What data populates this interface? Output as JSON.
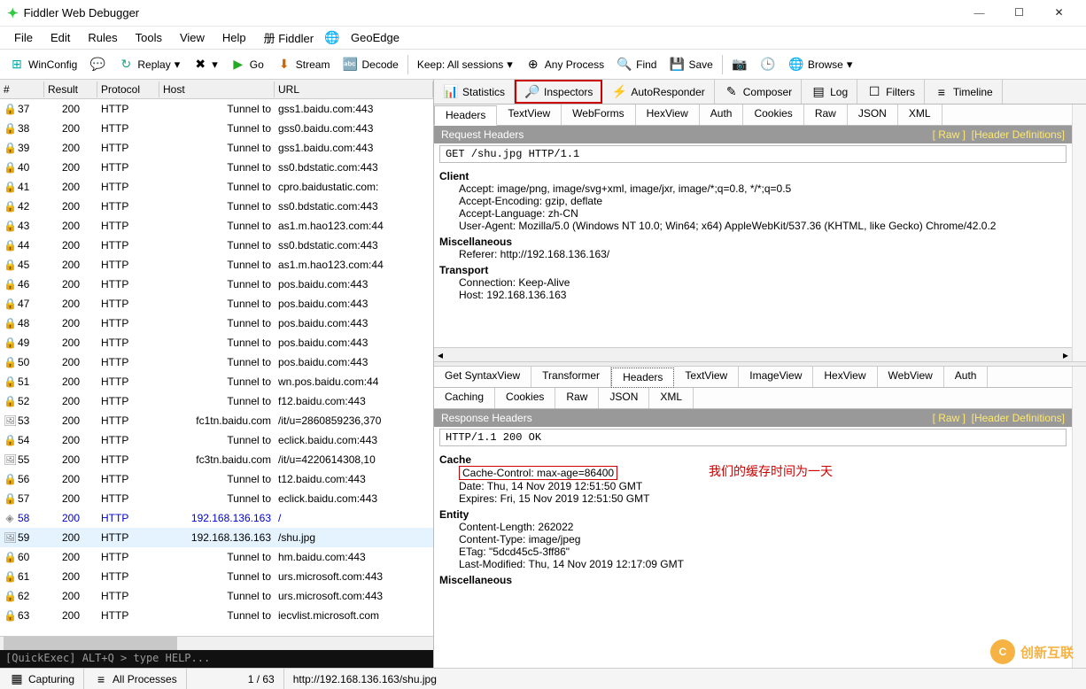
{
  "window": {
    "title": "Fiddler Web Debugger"
  },
  "winctrl": {
    "min": "—",
    "max": "☐",
    "close": "✕"
  },
  "menu": [
    "File",
    "Edit",
    "Rules",
    "Tools",
    "View",
    "Help",
    "册 Fiddler",
    "GeoEdge"
  ],
  "toolbar": {
    "winconfig": "WinConfig",
    "replay": "Replay",
    "go": "Go",
    "stream": "Stream",
    "decode": "Decode",
    "keep": "Keep: All sessions",
    "anyproc": "Any Process",
    "find": "Find",
    "save": "Save",
    "browse": "Browse"
  },
  "sess_cols": {
    "num": "#",
    "result": "Result",
    "protocol": "Protocol",
    "host": "Host",
    "url": "URL"
  },
  "sessions": [
    {
      "n": "37",
      "r": "200",
      "p": "HTTP",
      "h": "Tunnel to",
      "u": "gss1.baidu.com:443",
      "ic": "🔒"
    },
    {
      "n": "38",
      "r": "200",
      "p": "HTTP",
      "h": "Tunnel to",
      "u": "gss0.baidu.com:443",
      "ic": "🔒"
    },
    {
      "n": "39",
      "r": "200",
      "p": "HTTP",
      "h": "Tunnel to",
      "u": "gss1.baidu.com:443",
      "ic": "🔒"
    },
    {
      "n": "40",
      "r": "200",
      "p": "HTTP",
      "h": "Tunnel to",
      "u": "ss0.bdstatic.com:443",
      "ic": "🔒"
    },
    {
      "n": "41",
      "r": "200",
      "p": "HTTP",
      "h": "Tunnel to",
      "u": "cpro.baidustatic.com:",
      "ic": "🔒"
    },
    {
      "n": "42",
      "r": "200",
      "p": "HTTP",
      "h": "Tunnel to",
      "u": "ss0.bdstatic.com:443",
      "ic": "🔒"
    },
    {
      "n": "43",
      "r": "200",
      "p": "HTTP",
      "h": "Tunnel to",
      "u": "as1.m.hao123.com:44",
      "ic": "🔒"
    },
    {
      "n": "44",
      "r": "200",
      "p": "HTTP",
      "h": "Tunnel to",
      "u": "ss0.bdstatic.com:443",
      "ic": "🔒"
    },
    {
      "n": "45",
      "r": "200",
      "p": "HTTP",
      "h": "Tunnel to",
      "u": "as1.m.hao123.com:44",
      "ic": "🔒"
    },
    {
      "n": "46",
      "r": "200",
      "p": "HTTP",
      "h": "Tunnel to",
      "u": "pos.baidu.com:443",
      "ic": "🔒"
    },
    {
      "n": "47",
      "r": "200",
      "p": "HTTP",
      "h": "Tunnel to",
      "u": "pos.baidu.com:443",
      "ic": "🔒"
    },
    {
      "n": "48",
      "r": "200",
      "p": "HTTP",
      "h": "Tunnel to",
      "u": "pos.baidu.com:443",
      "ic": "🔒"
    },
    {
      "n": "49",
      "r": "200",
      "p": "HTTP",
      "h": "Tunnel to",
      "u": "pos.baidu.com:443",
      "ic": "🔒"
    },
    {
      "n": "50",
      "r": "200",
      "p": "HTTP",
      "h": "Tunnel to",
      "u": "pos.baidu.com:443",
      "ic": "🔒"
    },
    {
      "n": "51",
      "r": "200",
      "p": "HTTP",
      "h": "Tunnel to",
      "u": "wn.pos.baidu.com:44",
      "ic": "🔒"
    },
    {
      "n": "52",
      "r": "200",
      "p": "HTTP",
      "h": "Tunnel to",
      "u": "f12.baidu.com:443",
      "ic": "🔒"
    },
    {
      "n": "53",
      "r": "200",
      "p": "HTTP",
      "h": "fc1tn.baidu.com",
      "u": "/it/u=2860859236,370",
      "ic": "🖼"
    },
    {
      "n": "54",
      "r": "200",
      "p": "HTTP",
      "h": "Tunnel to",
      "u": "eclick.baidu.com:443",
      "ic": "🔒"
    },
    {
      "n": "55",
      "r": "200",
      "p": "HTTP",
      "h": "fc3tn.baidu.com",
      "u": "/it/u=4220614308,10",
      "ic": "🖼"
    },
    {
      "n": "56",
      "r": "200",
      "p": "HTTP",
      "h": "Tunnel to",
      "u": "t12.baidu.com:443",
      "ic": "🔒"
    },
    {
      "n": "57",
      "r": "200",
      "p": "HTTP",
      "h": "Tunnel to",
      "u": "eclick.baidu.com:443",
      "ic": "🔒"
    },
    {
      "n": "58",
      "r": "200",
      "p": "HTTP",
      "h": "192.168.136.163",
      "u": "/",
      "ic": "◈",
      "blue": true
    },
    {
      "n": "59",
      "r": "200",
      "p": "HTTP",
      "h": "192.168.136.163",
      "u": "/shu.jpg",
      "ic": "🖼",
      "sel": true
    },
    {
      "n": "60",
      "r": "200",
      "p": "HTTP",
      "h": "Tunnel to",
      "u": "hm.baidu.com:443",
      "ic": "🔒"
    },
    {
      "n": "61",
      "r": "200",
      "p": "HTTP",
      "h": "Tunnel to",
      "u": "urs.microsoft.com:443",
      "ic": "🔒"
    },
    {
      "n": "62",
      "r": "200",
      "p": "HTTP",
      "h": "Tunnel to",
      "u": "urs.microsoft.com:443",
      "ic": "🔒"
    },
    {
      "n": "63",
      "r": "200",
      "p": "HTTP",
      "h": "Tunnel to",
      "u": "iecvlist.microsoft.com",
      "ic": "🔒"
    }
  ],
  "view_tabs": {
    "statistics": "Statistics",
    "inspectors": "Inspectors",
    "autoresponder": "AutoResponder",
    "composer": "Composer",
    "log": "Log",
    "filters": "Filters",
    "timeline": "Timeline"
  },
  "req_tabs": [
    "Headers",
    "TextView",
    "WebForms",
    "HexView",
    "Auth",
    "Cookies",
    "Raw",
    "JSON",
    "XML"
  ],
  "req_panel": {
    "title": "Request Headers",
    "raw": "[ Raw ]",
    "defs": "[Header Definitions]"
  },
  "req_line": "GET /shu.jpg HTTP/1.1",
  "req_groups": [
    {
      "name": "Client",
      "lines": [
        "Accept: image/png, image/svg+xml, image/jxr, image/*;q=0.8, */*;q=0.5",
        "Accept-Encoding: gzip, deflate",
        "Accept-Language: zh-CN",
        "User-Agent: Mozilla/5.0 (Windows NT 10.0; Win64; x64) AppleWebKit/537.36 (KHTML, like Gecko) Chrome/42.0.2"
      ]
    },
    {
      "name": "Miscellaneous",
      "lines": [
        "Referer: http://192.168.136.163/"
      ]
    },
    {
      "name": "Transport",
      "lines": [
        "Connection: Keep-Alive",
        "Host: 192.168.136.163"
      ]
    }
  ],
  "resp_tabs1": [
    "Get SyntaxView",
    "Transformer",
    "Headers",
    "TextView",
    "ImageView",
    "HexView",
    "WebView",
    "Auth"
  ],
  "resp_tabs2": [
    "Caching",
    "Cookies",
    "Raw",
    "JSON",
    "XML"
  ],
  "resp_panel": {
    "title": "Response Headers",
    "raw": "[ Raw ]",
    "defs": "[Header Definitions]"
  },
  "resp_line": "HTTP/1.1 200 OK",
  "resp_groups": [
    {
      "name": "Cache",
      "lines": [
        "Cache-Control: max-age=86400",
        "Date: Thu, 14 Nov 2019 12:51:50 GMT",
        "Expires: Fri, 15 Nov 2019 12:51:50 GMT"
      ],
      "box": 0
    },
    {
      "name": "Entity",
      "lines": [
        "Content-Length: 262022",
        "Content-Type: image/jpeg",
        "ETag: \"5dcd45c5-3ff86\"",
        "Last-Modified: Thu, 14 Nov 2019 12:17:09 GMT"
      ]
    },
    {
      "name": "Miscellaneous",
      "lines": []
    }
  ],
  "annotation": "我们的缓存时间为一天",
  "quickexec": "[QuickExec] ALT+Q > type HELP...",
  "status": {
    "capturing": "Capturing",
    "allproc": "All Processes",
    "count": "1 / 63",
    "url": "http://192.168.136.163/shu.jpg"
  },
  "watermark": "创新互联"
}
